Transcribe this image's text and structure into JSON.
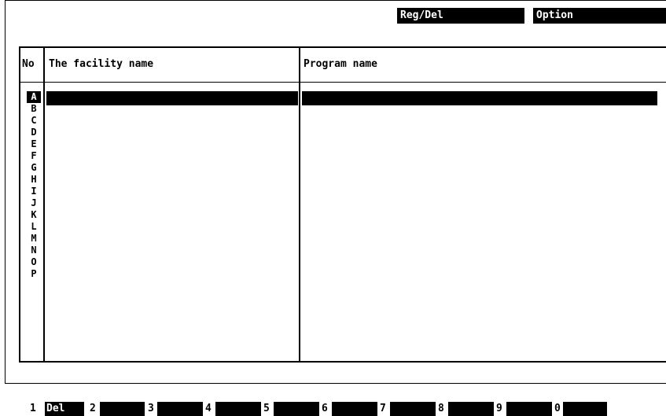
{
  "menu": {
    "reg_del": "Reg/Del",
    "option": "Option"
  },
  "table": {
    "columns": [
      "No",
      "The facility name",
      "Program name"
    ],
    "rows": [
      "A",
      "B",
      "C",
      "D",
      "E",
      "F",
      "G",
      "H",
      "I",
      "J",
      "K",
      "L",
      "M",
      "N",
      "O",
      "P"
    ],
    "selected_row": "A"
  },
  "function_keys": [
    {
      "key": "1",
      "label": "Del"
    },
    {
      "key": "2",
      "label": ""
    },
    {
      "key": "3",
      "label": ""
    },
    {
      "key": "4",
      "label": ""
    },
    {
      "key": "5",
      "label": ""
    },
    {
      "key": "6",
      "label": ""
    },
    {
      "key": "7",
      "label": ""
    },
    {
      "key": "8",
      "label": ""
    },
    {
      "key": "9",
      "label": ""
    },
    {
      "key": "0",
      "label": ""
    }
  ]
}
